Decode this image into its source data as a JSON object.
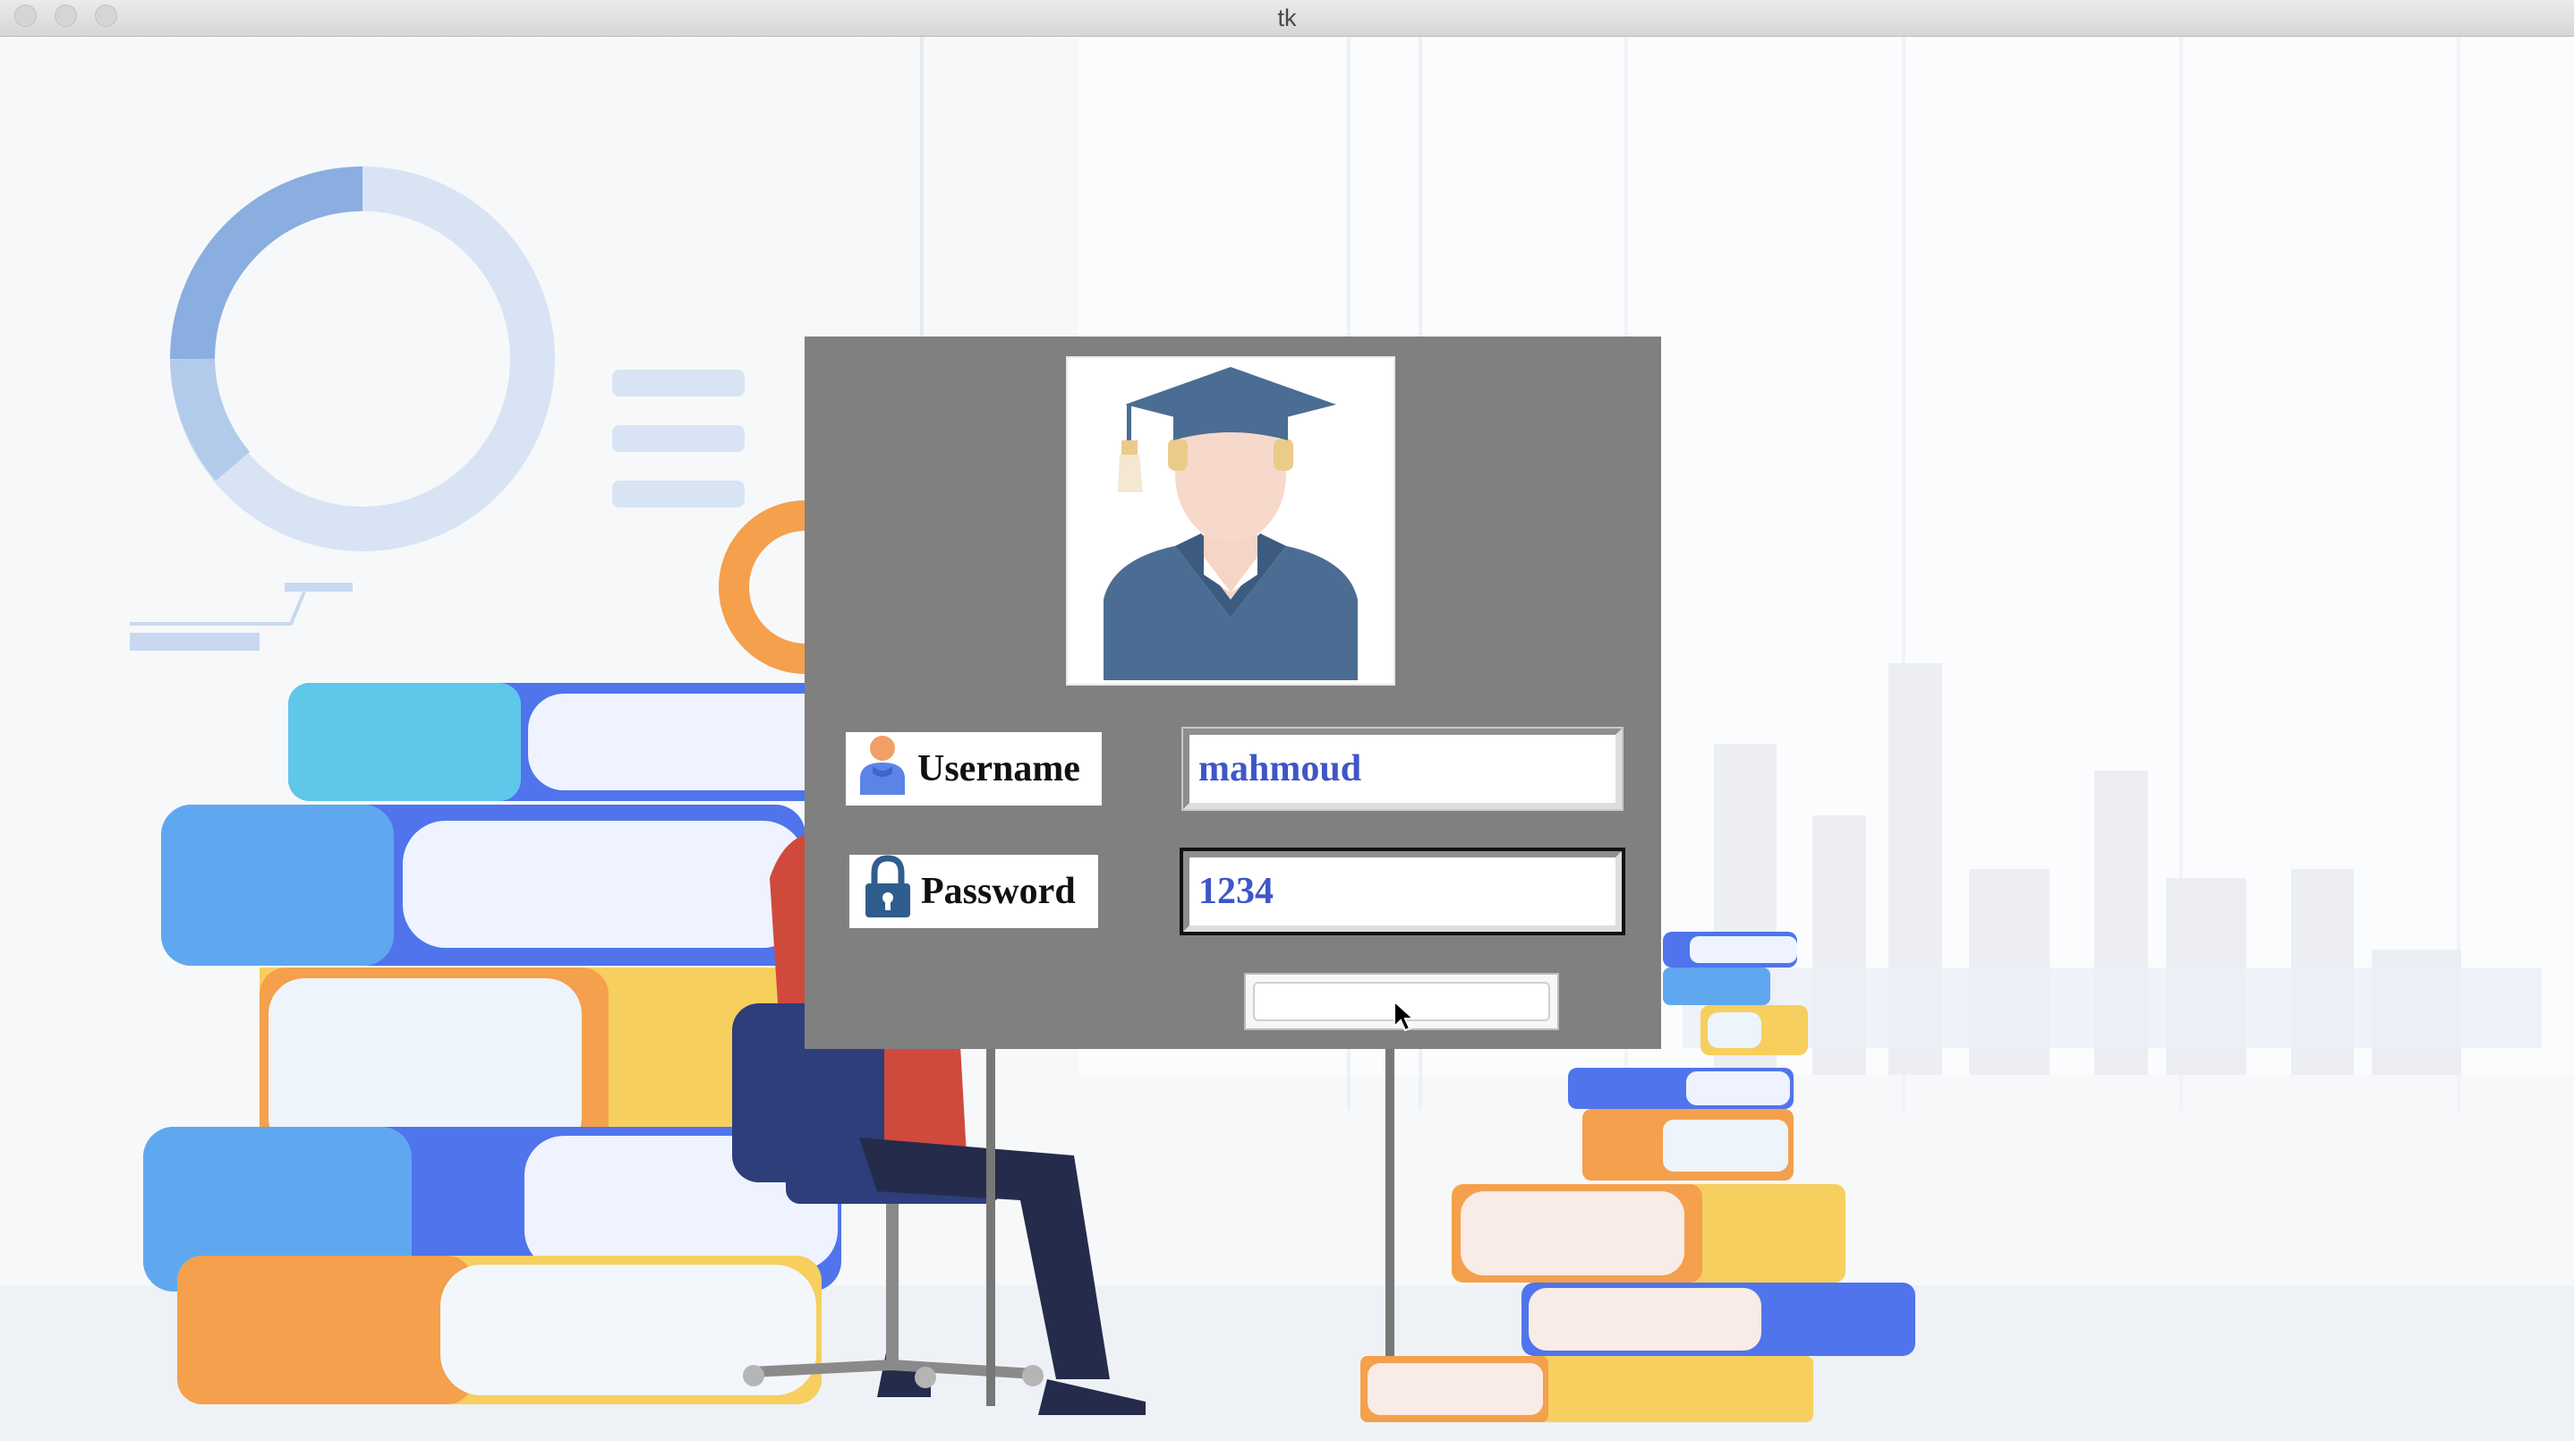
{
  "window": {
    "title": "tk"
  },
  "login": {
    "username": {
      "label": "Username",
      "value": "mahmoud",
      "icon": "user-icon"
    },
    "password": {
      "label": "Password",
      "value": "1234",
      "icon": "lock-icon"
    },
    "submit_label": ""
  },
  "colors": {
    "panel": "#808080",
    "entry_text": "#3f56c7",
    "book_blue": "#4f74ec",
    "book_orange": "#f4a04c",
    "book_yellow": "#f6cf5f",
    "donut": "#8aaee0"
  },
  "background": {
    "illustration": "student-reading-books-illustration"
  }
}
